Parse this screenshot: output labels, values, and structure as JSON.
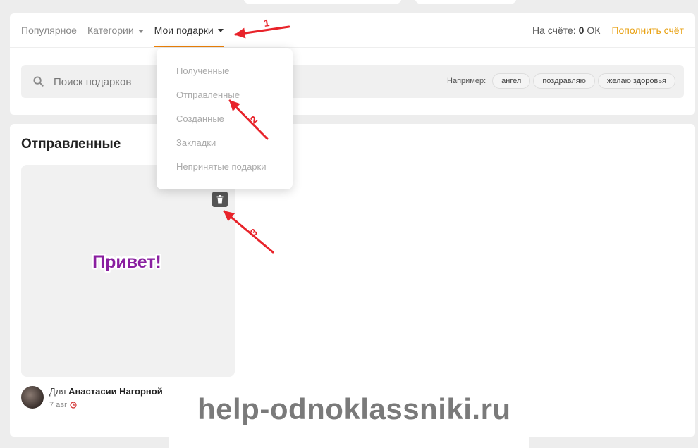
{
  "nav": {
    "popular": "Популярное",
    "categories": "Категории",
    "my_gifts": "Мои подарки"
  },
  "balance": {
    "label": "На счёте:",
    "amount": "0",
    "currency": "ОК",
    "topup": "Пополнить счёт"
  },
  "search": {
    "placeholder": "Поиск подарков",
    "examples_label": "Например:",
    "examples": [
      "ангел",
      "поздравляю",
      "желаю здоровья"
    ]
  },
  "dropdown": {
    "items": [
      "Полученные",
      "Отправленные",
      "Созданные",
      "Закладки",
      "Непринятые подарки"
    ]
  },
  "section": {
    "title": "Отправленные"
  },
  "gift": {
    "art_text": "Привет!",
    "for_label": "Для",
    "recipient": "Анастасии Нагорной",
    "date": "7 авг"
  },
  "annotations": [
    "1",
    "2",
    "3"
  ],
  "watermark": "help-odnoklassniki.ru",
  "colors": {
    "accent": "#ee8208",
    "topup": "#e8a010",
    "arrow": "#e8232a",
    "gift_art": "#8a1fa0"
  },
  "icons": [
    "search-icon",
    "caret-down-icon",
    "bookmark-icon",
    "trash-icon",
    "clock-icon"
  ]
}
